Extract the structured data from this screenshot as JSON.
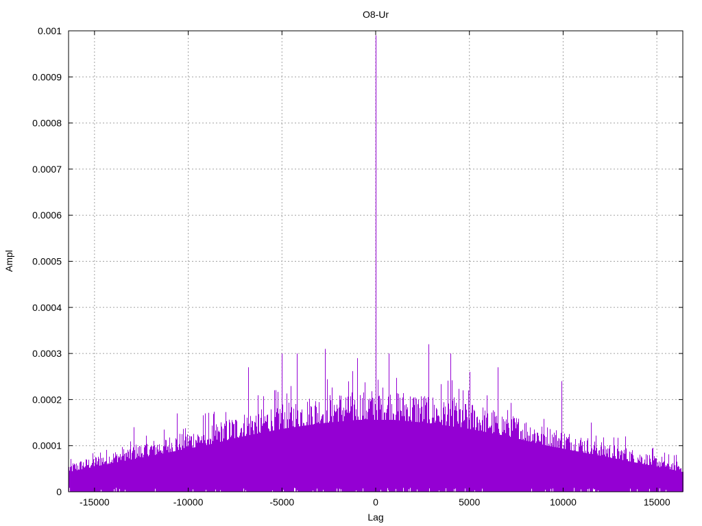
{
  "chart_data": {
    "type": "bar",
    "title": "O8-Ur",
    "xlabel": "Lag",
    "ylabel": "Ampl",
    "xlim": [
      -16384,
      16384
    ],
    "ylim": [
      0,
      0.001
    ],
    "xticks": [
      -15000,
      -10000,
      -5000,
      0,
      5000,
      10000,
      15000
    ],
    "yticks": [
      0,
      0.0001,
      0.0002,
      0.0003,
      0.0004,
      0.0005,
      0.0006,
      0.0007,
      0.0008,
      0.0009,
      0.001
    ],
    "xtick_labels": [
      "-15000",
      "-10000",
      "-5000",
      "0",
      "5000",
      "10000",
      "15000"
    ],
    "ytick_labels": [
      "0",
      "0.0001",
      "0.0002",
      "0.0003",
      "0.0004",
      "0.0005",
      "0.0006",
      "0.0007",
      "0.0008",
      "0.0009",
      "0.001"
    ],
    "grid": true,
    "bar_color": "#9400D3",
    "series": [
      {
        "envelope_x": [
          -16384,
          -15000,
          -13000,
          -11000,
          -9000,
          -7000,
          -5000,
          -3000,
          -1000,
          0,
          1000,
          3000,
          5000,
          7000,
          9000,
          11000,
          13000,
          15000,
          16384
        ],
        "envelope_y": [
          5.5e-05,
          7e-05,
          9e-05,
          0.00011,
          0.00013,
          0.000155,
          0.000175,
          0.00019,
          0.0002,
          0.0002,
          0.0002,
          0.00019,
          0.000175,
          0.000155,
          0.00013,
          0.00011,
          9e-05,
          7e-05,
          5.5e-05
        ],
        "peaks": [
          {
            "x": 0,
            "y": 0.00099
          },
          {
            "x": -6800,
            "y": 0.00027
          },
          {
            "x": -5000,
            "y": 0.0003
          },
          {
            "x": -4200,
            "y": 0.0003
          },
          {
            "x": -2700,
            "y": 0.00031
          },
          {
            "x": -1000,
            "y": 0.00029
          },
          {
            "x": 700,
            "y": 0.0003
          },
          {
            "x": 2800,
            "y": 0.00032
          },
          {
            "x": 4000,
            "y": 0.0003
          },
          {
            "x": 5000,
            "y": 0.00026
          },
          {
            "x": 6500,
            "y": 0.00027
          },
          {
            "x": 9900,
            "y": 0.00024
          },
          {
            "x": -14700,
            "y": 8.5e-05
          },
          {
            "x": -12900,
            "y": 0.00014
          },
          {
            "x": -10600,
            "y": 0.00017
          },
          {
            "x": -9100,
            "y": 0.00017
          },
          {
            "x": 11500,
            "y": 0.00015
          },
          {
            "x": 13300,
            "y": 0.00012
          },
          {
            "x": 16000,
            "y": 8e-05
          }
        ]
      }
    ]
  }
}
